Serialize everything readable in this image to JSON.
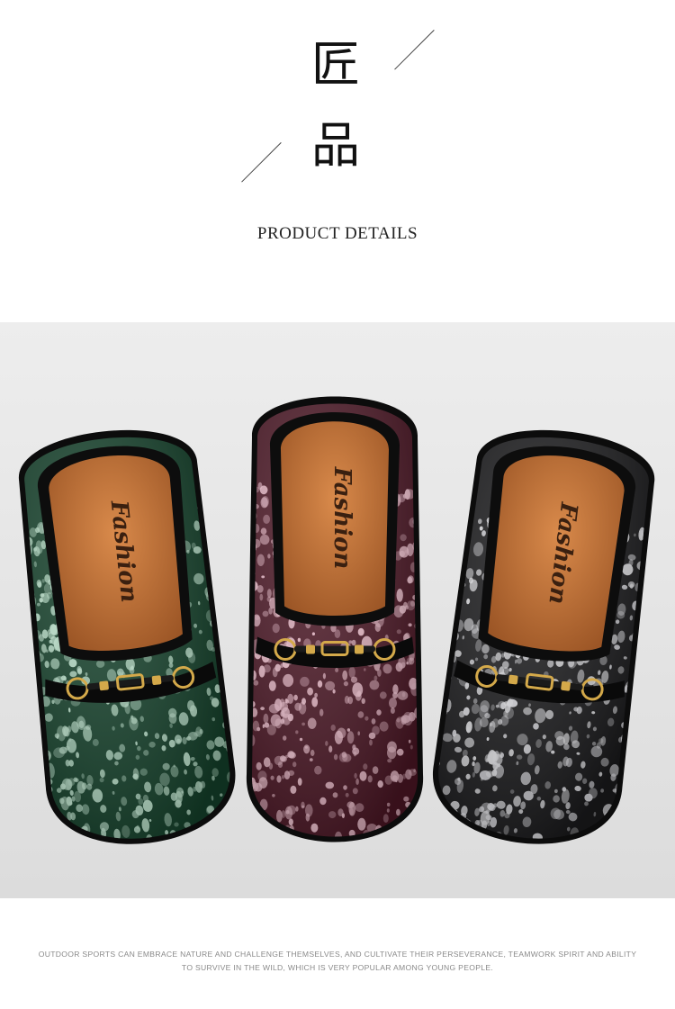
{
  "header": {
    "char_1": "匠",
    "char_2": "品",
    "subtitle": "PRODUCT DETAILS"
  },
  "photo": {
    "insole_text": "Fashion",
    "shoes": [
      {
        "color_name": "green",
        "upper": "#14402a",
        "dot": "#bfe5cf",
        "rim": "#0c0c0c"
      },
      {
        "color_name": "burgundy",
        "upper": "#4a1624",
        "dot": "#f0c2d0",
        "rim": "#0c0c0c"
      },
      {
        "color_name": "black",
        "upper": "#1a1a1c",
        "dot": "#e2e2e6",
        "rim": "#0c0c0c"
      }
    ],
    "insole_color": "#c0733a",
    "background": "#e6e6e6",
    "buckle_color": "#d4a94a"
  },
  "caption": {
    "line_1": "OUTDOOR SPORTS CAN EMBRACE NATURE AND CHALLENGE THEMSELVES, AND CULTIVATE THEIR PERSEVERANCE, TEAMWORK SPIRIT AND ABILITY",
    "line_2": "TO SURVIVE IN THE WILD, WHICH IS VERY POPULAR AMONG YOUNG PEOPLE."
  }
}
